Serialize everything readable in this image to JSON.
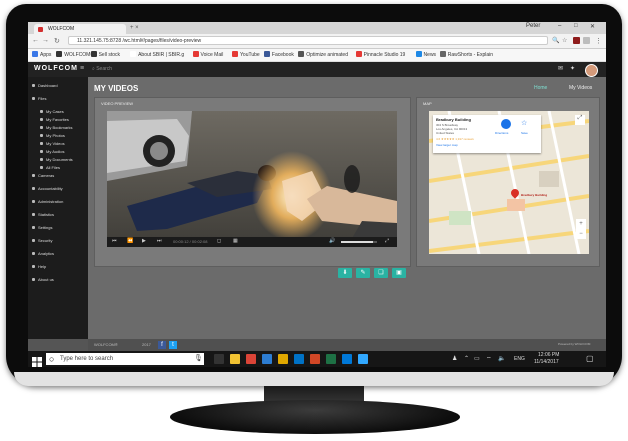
{
  "browser": {
    "tab_title": "WOLFCOM",
    "new_tab_symbol": "+ ×",
    "window_user": "Peter",
    "url": "11.321.145.75:8728 /wc.html#/pages/files/video-preview",
    "bookmarks": [
      {
        "label": "Apps",
        "color": "#3b78e7"
      },
      {
        "label": "WOLFCOM®",
        "color": "#333333"
      },
      {
        "label": "Sell stock",
        "color": "#333333"
      },
      {
        "label": "About SBIR | SBIR.g",
        "color": "#ffffff"
      },
      {
        "label": "Voice Mail",
        "color": "#e53935"
      },
      {
        "label": "YouTube",
        "color": "#e53935"
      },
      {
        "label": "Facebook",
        "color": "#3b5998"
      },
      {
        "label": "Optimize animated",
        "color": "#555555"
      },
      {
        "label": "Pinnacle Studio 19",
        "color": "#e53935"
      },
      {
        "label": "News",
        "color": "#1e88e5"
      },
      {
        "label": "RawShorts - Explain",
        "color": "#666666"
      }
    ]
  },
  "app": {
    "logo": "WOLFCOM",
    "search_placeholder": "Search",
    "sidebar": [
      {
        "label": "Dashboard",
        "child": false
      },
      {
        "label": "Files",
        "child": false
      },
      {
        "label": "My Cases",
        "child": true
      },
      {
        "label": "My Favorites",
        "child": true
      },
      {
        "label": "My Bookmarks",
        "child": true
      },
      {
        "label": "My Photos",
        "child": true
      },
      {
        "label": "My Videos",
        "child": true
      },
      {
        "label": "My Audios",
        "child": true
      },
      {
        "label": "My Documents",
        "child": true
      },
      {
        "label": "All Files",
        "child": true
      },
      {
        "label": "Cameras",
        "child": false
      },
      {
        "label": "Accountability",
        "child": false
      },
      {
        "label": "Administration",
        "child": false
      },
      {
        "label": "Statistics",
        "child": false
      },
      {
        "label": "Settings",
        "child": false
      },
      {
        "label": "Security",
        "child": false
      },
      {
        "label": "Analytics",
        "child": false
      },
      {
        "label": "Help",
        "child": false
      },
      {
        "label": "About us",
        "child": false
      }
    ],
    "page_title": "MY VIDEOS",
    "breadcrumb_home": "Home",
    "breadcrumb_current": "My Videos",
    "video_panel_title": "VIDEO PREVIEW",
    "map_panel_title": "MAP",
    "map_card": {
      "title": "Bradbury Building",
      "lines": [
        "304 S Broadway",
        "Los Angeles, CA 90013",
        "United States"
      ],
      "rating": "4.6 ★★★★★ 1,917 reviews",
      "link": "View larger map",
      "directions": "Directions",
      "save": "Save"
    },
    "map_pin_label": "Bradbury Building",
    "video_time": "00:00:12 / 00:02:08",
    "video_progress": 0.05,
    "volume_level": 0.9,
    "action_buttons": [
      "download-icon",
      "edit-icon",
      "bookmark-icon",
      "share-icon"
    ],
    "footer_copyright": "WOLFCOM®",
    "footer_year": "2017",
    "footer_powered": "Powered by WOLFCOM"
  },
  "taskbar": {
    "search_placeholder": "Type here to search",
    "language": "ENG",
    "time": "12:06 PM",
    "date": "11/14/2017"
  }
}
